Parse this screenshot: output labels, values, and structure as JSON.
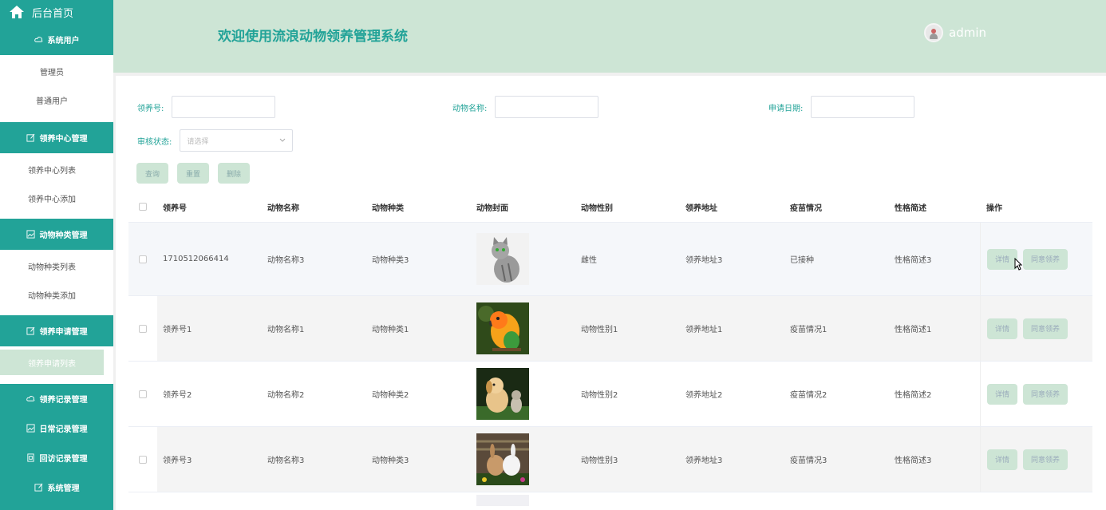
{
  "sidebar": {
    "home": "后台首页",
    "groups": [
      {
        "label": "系统用户",
        "items": [
          "管理员",
          "普通用户"
        ]
      },
      {
        "label": "领养中心管理",
        "items": [
          "领养中心列表",
          "领养中心添加"
        ]
      },
      {
        "label": "动物种类管理",
        "items": [
          "动物种类列表",
          "动物种类添加"
        ]
      },
      {
        "label": "领养申请管理",
        "items": [
          "领养申请列表"
        ]
      }
    ],
    "bottom_groups": [
      "领养记录管理",
      "日常记录管理",
      "回访记录管理",
      "系统管理"
    ]
  },
  "header": {
    "title": "欢迎使用流浪动物领养管理系统",
    "user": "admin"
  },
  "search": {
    "adopt_no_label": "领养号:",
    "animal_name_label": "动物名称:",
    "apply_date_label": "申请日期:",
    "status_label": "审核状态:",
    "status_placeholder": "请选择",
    "query_btn": "查询",
    "reset_btn": "重置",
    "delete_btn": "删除"
  },
  "table": {
    "columns": [
      "领养号",
      "动物名称",
      "动物种类",
      "动物封面",
      "动物性别",
      "领养地址",
      "疫苗情况",
      "性格简述",
      "操作"
    ],
    "rows": [
      {
        "no": "1710512066414",
        "name": "动物名称3",
        "kind": "动物种类3",
        "image": "cat",
        "gender": "雌性",
        "address": "领养地址3",
        "vaccine": "已接种",
        "trait": "性格简述3"
      },
      {
        "no": "领养号1",
        "name": "动物名称1",
        "kind": "动物种类1",
        "image": "parrot",
        "gender": "动物性别1",
        "address": "领养地址1",
        "vaccine": "疫苗情况1",
        "trait": "性格简述1"
      },
      {
        "no": "领养号2",
        "name": "动物名称2",
        "kind": "动物种类2",
        "image": "dog-cat",
        "gender": "动物性别2",
        "address": "领养地址2",
        "vaccine": "疫苗情况2",
        "trait": "性格简述2"
      },
      {
        "no": "领养号3",
        "name": "动物名称3",
        "kind": "动物种类3",
        "image": "rabbits",
        "gender": "动物性别3",
        "address": "领养地址3",
        "vaccine": "疫苗情况3",
        "trait": "性格简述3"
      }
    ],
    "detail_btn": "详情",
    "agree_btn": "同意领养"
  },
  "colors": {
    "primary": "#22a398",
    "light": "#cde5d5"
  }
}
